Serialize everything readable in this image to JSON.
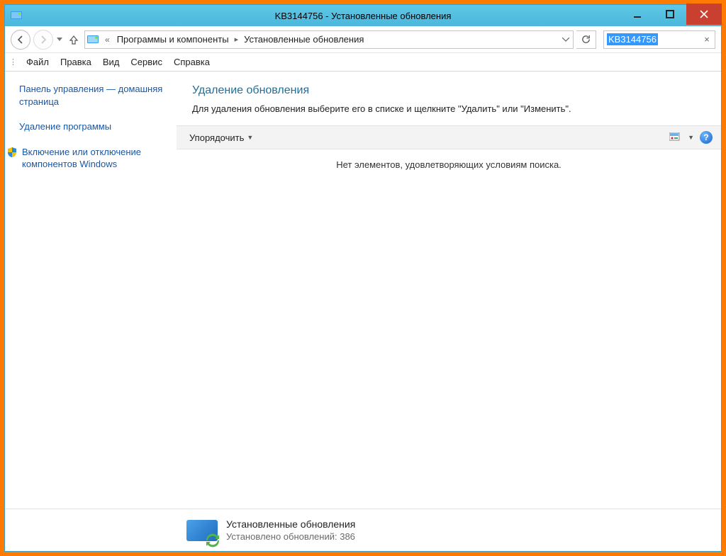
{
  "window": {
    "title": "KB3144756 - Установленные обновления"
  },
  "breadcrumb": {
    "item1": "Программы и компоненты",
    "item2": "Установленные обновления"
  },
  "search": {
    "query": "KB3144756"
  },
  "menu": {
    "file": "Файл",
    "edit": "Правка",
    "view": "Вид",
    "tools": "Сервис",
    "help": "Справка"
  },
  "sidebar": {
    "home": "Панель управления — домашняя страница",
    "uninstall": "Удаление программы",
    "features": "Включение или отключение компонентов Windows"
  },
  "main": {
    "heading": "Удаление обновления",
    "instruction": "Для удаления обновления выберите его в списке и щелкните \"Удалить\" или \"Изменить\".",
    "organize": "Упорядочить",
    "empty": "Нет элементов, удовлетворяющих условиям поиска."
  },
  "status": {
    "title": "Установленные обновления",
    "subtitle": "Установлено обновлений: 386"
  }
}
